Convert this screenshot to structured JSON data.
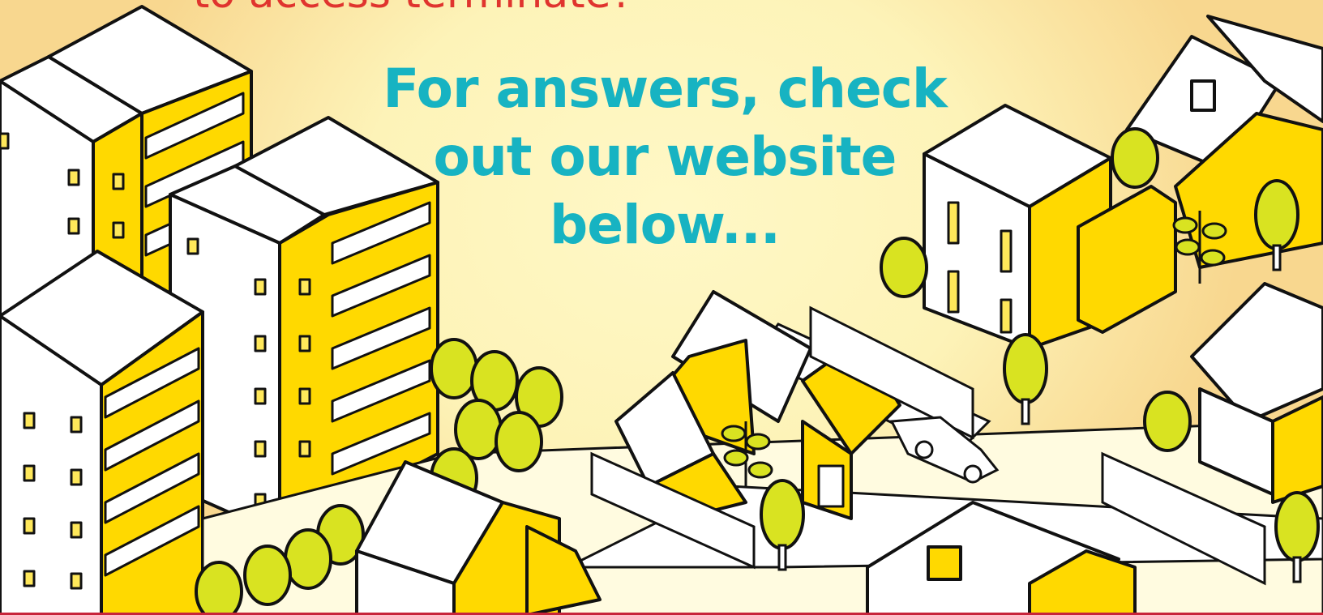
{
  "heading_partial": "to access terminate?",
  "headline": {
    "line1": "For answers, check",
    "line2": "out our website",
    "line3": "below..."
  },
  "colors": {
    "heading_red": "#e0342e",
    "headline_teal": "#17b3c2",
    "building_yellow": "#ffd900",
    "tree_green": "#d9e321",
    "outline": "#111111",
    "footer_rule": "#c8243a"
  },
  "illustration": {
    "subject": "isometric-town",
    "icons": [
      "apartment-building",
      "house",
      "tree",
      "car",
      "fence"
    ]
  }
}
